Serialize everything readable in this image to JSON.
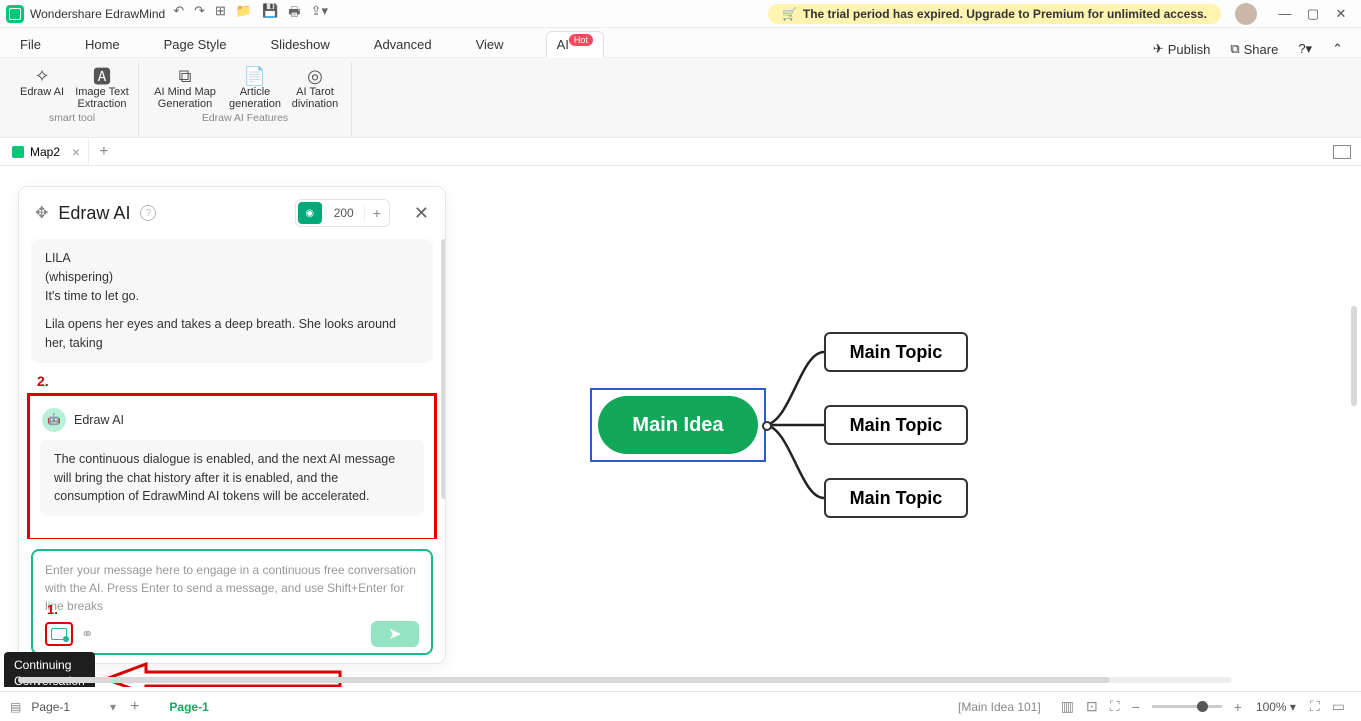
{
  "titlebar": {
    "app_name": "Wondershare EdrawMind",
    "trial_text": "The trial period has expired. Upgrade to Premium for unlimited access."
  },
  "menu": {
    "items": [
      "File",
      "Home",
      "Page Style",
      "Slideshow",
      "Advanced",
      "View",
      "AI"
    ],
    "hot_badge": "Hot",
    "publish": "Publish",
    "share": "Share"
  },
  "ribbon": {
    "btn1": "Edraw AI",
    "btn2_l1": "Image Text",
    "btn2_l2": "Extraction",
    "group1_label": "smart tool",
    "btn3_l1": "AI Mind Map",
    "btn3_l2": "Generation",
    "btn4_l1": "Article",
    "btn4_l2": "generation",
    "btn5_l1": "AI Tarot",
    "btn5_l2": "divination",
    "group2_label": "Edraw AI Features"
  },
  "doctab": {
    "name": "Map2"
  },
  "ai_panel": {
    "title": "Edraw AI",
    "tokens": "200",
    "msg1_l1": "LILA",
    "msg1_l2": "(whispering)",
    "msg1_l3": "It's time to let go.",
    "msg1_l4": "Lila opens her eyes and takes a deep breath. She looks around her, taking",
    "step2": "2.",
    "from_name": "Edraw AI",
    "msg2": "The continuous dialogue is enabled, and the next AI message will bring the chat history after it is enabled, and the consumption of EdrawMind AI tokens will be accelerated.",
    "placeholder": "Enter your message here to engage in a continuous free conversation with the AI. Press Enter to send a message, and use Shift+Enter for line breaks",
    "step1": "1.",
    "tooltip_l1": "Continuing",
    "tooltip_l2": "Conversation"
  },
  "mindmap": {
    "main": "Main Idea",
    "topic1": "Main Topic",
    "topic2": "Main Topic",
    "topic3": "Main Topic"
  },
  "status": {
    "page_label": "Page-1",
    "page_active": "Page-1",
    "selection": "[Main Idea 101]",
    "zoom": "100%"
  }
}
